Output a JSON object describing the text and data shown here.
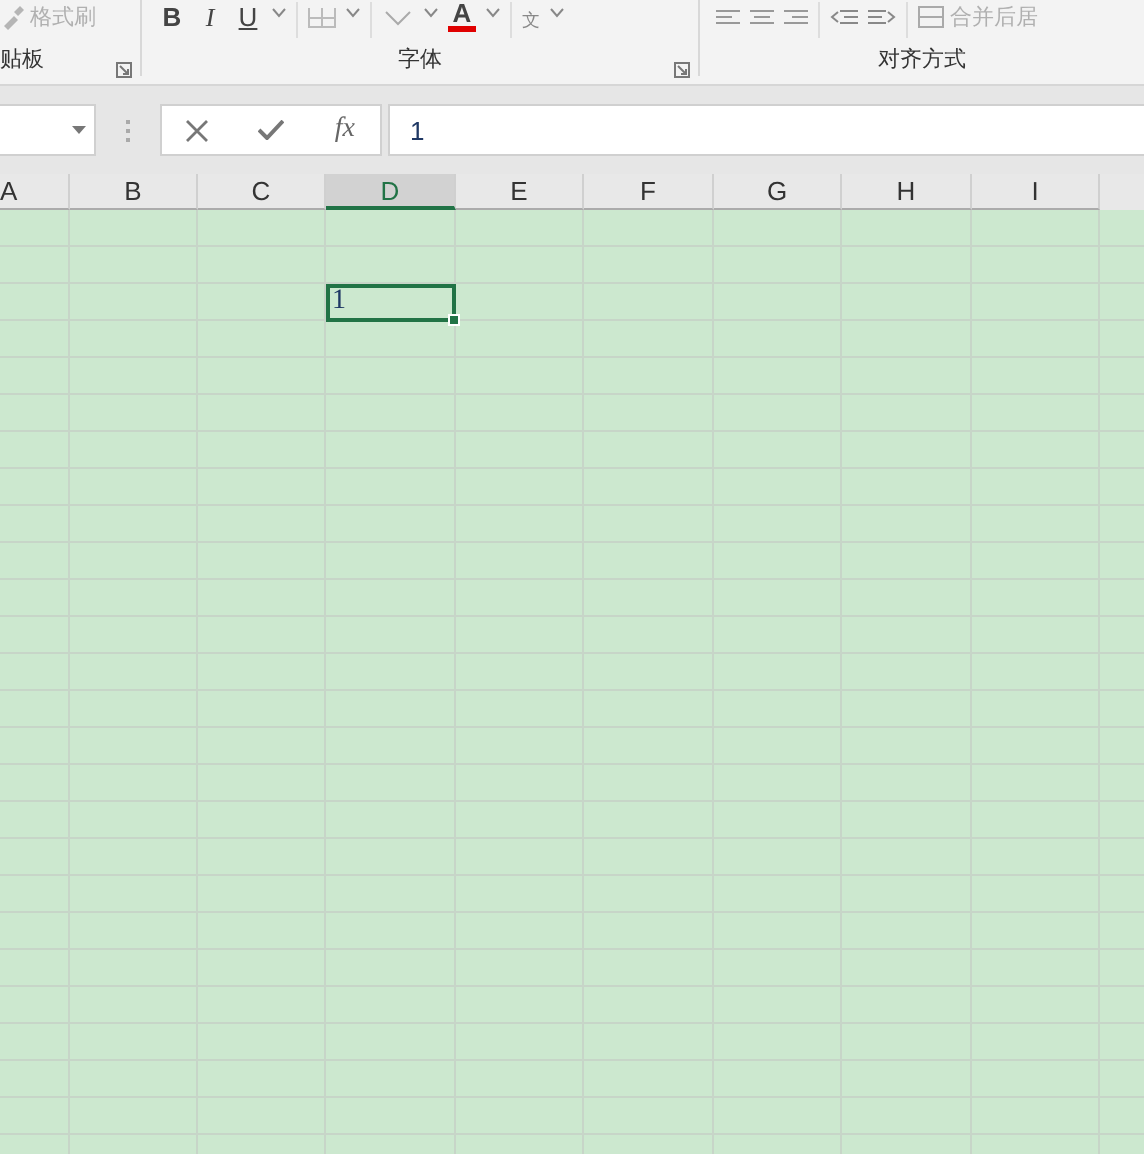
{
  "ribbon": {
    "groups": [
      {
        "label": "贴板",
        "launcher": true,
        "items": [
          {
            "kind": "brush",
            "label": "格式刷",
            "disabled": true
          }
        ]
      },
      {
        "label": "字体",
        "launcher": true,
        "items": [
          {
            "kind": "bold",
            "label": "B"
          },
          {
            "kind": "italic",
            "label": "I"
          },
          {
            "kind": "underline",
            "label": "U"
          },
          {
            "kind": "border"
          },
          {
            "kind": "fill"
          },
          {
            "kind": "fontcolor",
            "label": "A"
          },
          {
            "kind": "phonetic",
            "label": "文"
          }
        ]
      },
      {
        "label": "对齐方式",
        "launcher": false,
        "items": [
          {
            "kind": "align-left"
          },
          {
            "kind": "align-center"
          },
          {
            "kind": "align-right"
          },
          {
            "kind": "outdent"
          },
          {
            "kind": "indent"
          },
          {
            "kind": "merge",
            "label": "合并后居",
            "disabled": true
          }
        ]
      }
    ]
  },
  "formula_bar": {
    "fx": "fx",
    "value": "1"
  },
  "sheet": {
    "columns": [
      {
        "label": "A",
        "selected": false
      },
      {
        "label": "B",
        "selected": false
      },
      {
        "label": "C",
        "selected": false
      },
      {
        "label": "D",
        "selected": true
      },
      {
        "label": "E",
        "selected": false
      },
      {
        "label": "F",
        "selected": false
      },
      {
        "label": "G",
        "selected": false
      },
      {
        "label": "H",
        "selected": false
      },
      {
        "label": "I",
        "selected": false
      }
    ],
    "rows": [
      {},
      {},
      {
        "cells": [
          null,
          null,
          null,
          {
            "value": "1",
            "selected": true
          }
        ]
      }
    ]
  }
}
